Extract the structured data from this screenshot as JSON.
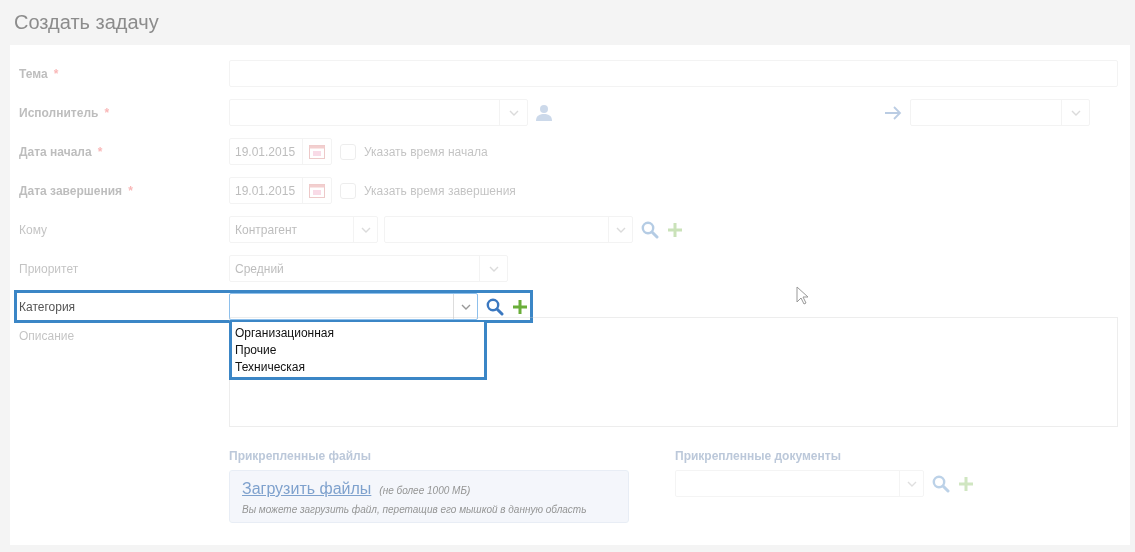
{
  "title": "Создать задачу",
  "fields": [
    {
      "kind": "text",
      "label": "Тема",
      "required_mark": "*",
      "highlighted": false
    },
    {
      "kind": "assignee",
      "label": "Исполнитель",
      "required_mark": "*",
      "highlighted": false
    },
    {
      "kind": "date",
      "label": "Дата начала",
      "required_mark": "*",
      "value": "19.01.2015",
      "checkbox_label": "Указать время начала",
      "checked": false,
      "highlighted": false
    },
    {
      "kind": "date",
      "label": "Дата завершения",
      "required_mark": "*",
      "value": "19.01.2015",
      "checkbox_label": "Указать время завершения",
      "checked": false,
      "highlighted": false
    },
    {
      "kind": "recipient",
      "label": "Кому",
      "value": "Контрагент",
      "highlighted": false
    },
    {
      "kind": "select",
      "label": "Приоритет",
      "value": "Средний",
      "highlighted": false
    },
    {
      "kind": "category",
      "label": "Категория",
      "expanded": true,
      "highlighted": true,
      "options": [
        "Организационная",
        "Прочие",
        "Техническая"
      ]
    },
    {
      "kind": "textarea",
      "label": "Описание",
      "highlighted": false
    }
  ],
  "attachments": {
    "files_label": "Прикрепленные файлы",
    "upload_link": "Загрузить файлы",
    "upload_limit": "(не более 1000 МБ)",
    "upload_hint": "Вы можете загрузить файл, перетащив его мышкой в данную область",
    "documents_label": "Прикрепленные документы"
  }
}
